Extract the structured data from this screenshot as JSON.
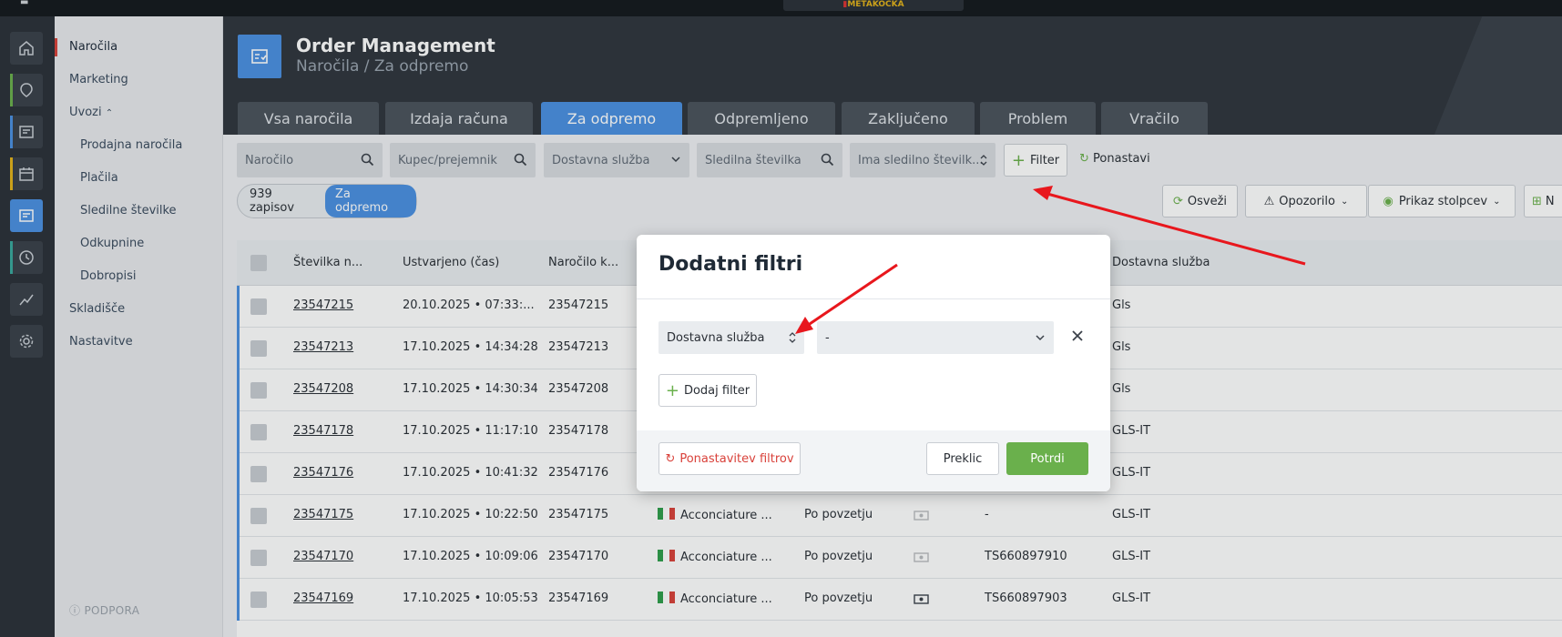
{
  "app": {
    "logo_text": "METAKOCKA"
  },
  "sidebar": {
    "items": [
      {
        "label": "Naročila"
      },
      {
        "label": "Marketing"
      },
      {
        "label": "Uvozi"
      },
      {
        "label": "Prodajna naročila"
      },
      {
        "label": "Plačila"
      },
      {
        "label": "Sledilne številke"
      },
      {
        "label": "Odkupnine"
      },
      {
        "label": "Dobropisi"
      },
      {
        "label": "Skladišče"
      },
      {
        "label": "Nastavitve"
      }
    ],
    "support": "PODPORA"
  },
  "header": {
    "title": "Order Management",
    "breadcrumb": "Naročila / Za odpremo"
  },
  "tabs": [
    {
      "label": "Vsa naročila"
    },
    {
      "label": "Izdaja računa"
    },
    {
      "label": "Za odpremo"
    },
    {
      "label": "Odpremljeno"
    },
    {
      "label": "Zaključeno"
    },
    {
      "label": "Problem"
    },
    {
      "label": "Vračilo"
    }
  ],
  "filters": {
    "order": "Naročilo",
    "buyer": "Kupec/prejemnik",
    "delivery": "Dostavna služba",
    "tracking": "Sledilna številka",
    "has_tracking": "Ima sledilno številk...",
    "filter_button": "Filter",
    "reset_button": "Ponastavi"
  },
  "toolbar": {
    "refresh": "Osveži",
    "warning": "Opozorilo",
    "columns": "Prikaz stolpcev",
    "more": "N"
  },
  "counter": {
    "records": "939 zapisov",
    "tag": "Za odpremo"
  },
  "table": {
    "headers": {
      "number": "Številka n...",
      "created": "Ustvarjeno (čas)",
      "order_k": "Naročilo k...",
      "delivery": "Dostavna služba"
    },
    "rows": [
      {
        "number": "23547215",
        "created": "20.10.2025 • 07:33:...",
        "order_k": "23547215",
        "customer": "",
        "payment": "",
        "tracking": "",
        "delivery": "Gls"
      },
      {
        "number": "23547213",
        "created": "17.10.2025 • 14:34:28",
        "order_k": "23547213",
        "customer": "",
        "payment": "",
        "tracking": "",
        "delivery": "Gls"
      },
      {
        "number": "23547208",
        "created": "17.10.2025 • 14:30:34",
        "order_k": "23547208",
        "customer": "",
        "payment": "",
        "tracking": "",
        "delivery": "Gls"
      },
      {
        "number": "23547178",
        "created": "17.10.2025 • 11:17:10",
        "order_k": "23547178",
        "customer": "",
        "payment": "",
        "tracking": "",
        "delivery": "GLS-IT"
      },
      {
        "number": "23547176",
        "created": "17.10.2025 • 10:41:32",
        "order_k": "23547176",
        "customer": "",
        "payment": "",
        "tracking": "",
        "delivery": "GLS-IT"
      },
      {
        "number": "23547175",
        "created": "17.10.2025 • 10:22:50",
        "order_k": "23547175",
        "customer": "Acconciature ...",
        "payment": "Po povzetju",
        "tracking": "-",
        "delivery": "GLS-IT"
      },
      {
        "number": "23547170",
        "created": "17.10.2025 • 10:09:06",
        "order_k": "23547170",
        "customer": "Acconciature ...",
        "payment": "Po povzetju",
        "tracking": "TS660897910",
        "delivery": "GLS-IT"
      },
      {
        "number": "23547169",
        "created": "17.10.2025 • 10:05:53",
        "order_k": "23547169",
        "customer": "Acconciature ...",
        "payment": "Po povzetju",
        "tracking": "TS660897903",
        "delivery": "GLS-IT"
      }
    ]
  },
  "modal": {
    "title": "Dodatni filtri",
    "field": "Dostavna služba",
    "value": "-",
    "add_filter": "Dodaj filter",
    "reset_filters": "Ponastavitev filtrov",
    "cancel": "Preklic",
    "confirm": "Potrdi"
  },
  "colors": {
    "accent": "#4a90e2",
    "confirm": "#6ab04c",
    "danger": "#d9413a",
    "annotation": "#e8171d"
  },
  "icons": [
    "home-icon",
    "map-pin-icon",
    "orders-icon",
    "calendar-icon",
    "clock-icon",
    "chart-icon",
    "gear-icon",
    "search-icon",
    "chevron-down-icon",
    "sort-icon",
    "plus-icon",
    "refresh-icon",
    "warning-icon",
    "eye-icon",
    "close-icon",
    "info-icon",
    "flag-it-icon",
    "cash-icon"
  ]
}
